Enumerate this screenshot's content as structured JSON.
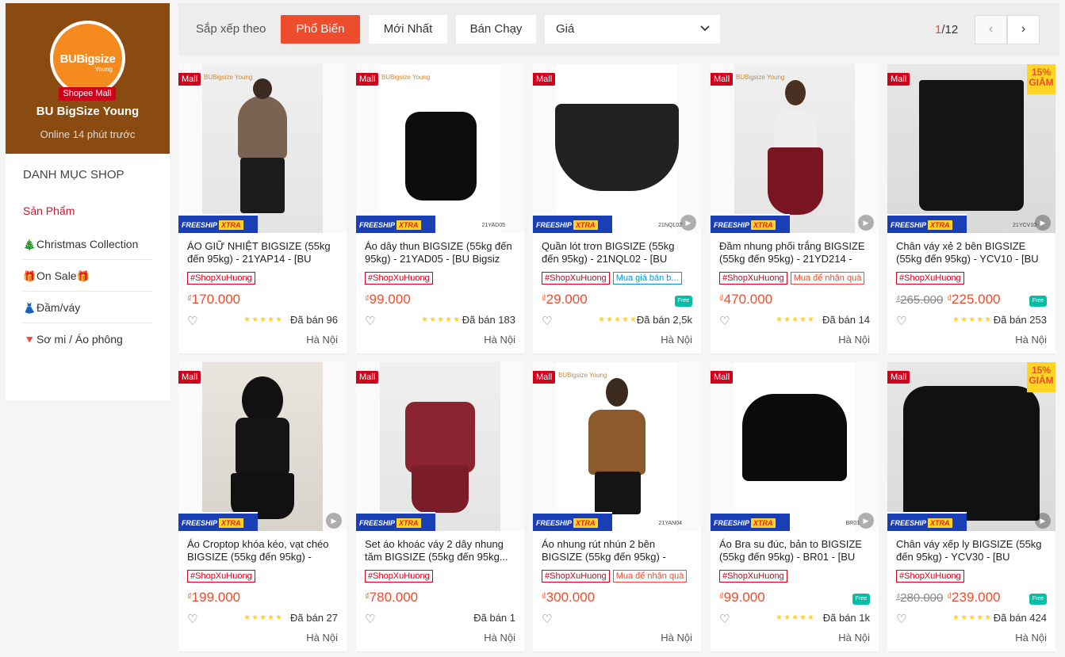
{
  "shop": {
    "avatar_name": "BUBigsize",
    "avatar_sub": "Young",
    "mall_badge": "Shopee Mall",
    "name": "BU BigSize Young",
    "status": "Online 14 phút trước"
  },
  "categories": {
    "title": "DANH MỤC SHOP",
    "items": [
      {
        "label": "Sản Phẩm",
        "icon": ""
      },
      {
        "label": "Christmas Collection",
        "icon": "christmas-tree-icon"
      },
      {
        "label": "On Sale",
        "icon": "gift-icon"
      },
      {
        "label": "Đầm/váy",
        "icon": "dress-icon"
      },
      {
        "label": "Sơ mi / Áo phông",
        "icon": "down-triangle-icon"
      }
    ]
  },
  "sortbar": {
    "label": "Sắp xếp theo",
    "options": [
      "Phổ Biến",
      "Mới Nhất",
      "Bán Chạy"
    ],
    "active": "Phổ Biến",
    "price_label": "Giá",
    "page_current": "1",
    "page_total": "/12"
  },
  "common": {
    "mall_tag": "Mall",
    "freeship": "FREESHIP",
    "xtra": "XTRA",
    "currency": "₫",
    "free_label": "Free",
    "brand_mark": "BUBigsize Young"
  },
  "products": [
    {
      "title": "ÁO GIỮ NHIỆT BIGSIZE (55kg đến 95kg) - 21YAP14 - [BU",
      "tags": [
        "#ShopXuHuong"
      ],
      "price": "170.000",
      "old_price": "",
      "sold": "Đã bán 96",
      "location": "Hà Nội",
      "stars": "★★★★★",
      "discount": "",
      "sku": "",
      "free": false,
      "play": false
    },
    {
      "title": "Áo dây thun BIGSIZE (55kg đến 95kg) - 21YAD05 - [BU Bigsiz",
      "tags": [
        "#ShopXuHuong"
      ],
      "price": "99.000",
      "old_price": "",
      "sold": "Đã bán 183",
      "location": "Hà Nội",
      "stars": "★★★★★",
      "discount": "",
      "sku": "21YAD05",
      "free": false,
      "play": false
    },
    {
      "title": "Quần lót trơn BIGSIZE (55kg đến 95kg) - 21NQL02 - [BU",
      "tags": [
        "#ShopXuHuong",
        "Mua giá bán b..."
      ],
      "price": "29.000",
      "old_price": "",
      "sold": "Đã bán 2,5k",
      "location": "Hà Nội",
      "stars": "★★★★★",
      "discount": "",
      "sku": "21NQL02",
      "free": true,
      "play": true
    },
    {
      "title": "Đầm nhung phối trắng BIGSIZE (55kg đến 95kg) - 21YD214 -",
      "tags": [
        "#ShopXuHuong",
        "Mua để nhận quà"
      ],
      "price": "470.000",
      "old_price": "",
      "sold": "Đã bán 14",
      "location": "Hà Nội",
      "stars": "★★★★★",
      "discount": "",
      "sku": "",
      "free": false,
      "play": true
    },
    {
      "title": "Chân váy xẻ 2 bên BIGSIZE (55kg đến 95kg) - YCV10 - [BU",
      "tags": [
        "#ShopXuHuong"
      ],
      "price": "225.000",
      "old_price": "265.000",
      "sold": "Đã bán 253",
      "location": "Hà Nội",
      "stars": "★★★★★",
      "discount": "15%\nGIẢM",
      "sku": "21YCV10",
      "free": true,
      "play": true
    },
    {
      "title": "Áo Croptop khóa kéo, vạt chéo BIGSIZE (55kg đến 95kg) -",
      "tags": [
        "#ShopXuHuong"
      ],
      "price": "199.000",
      "old_price": "",
      "sold": "Đã bán 27",
      "location": "Hà Nội",
      "stars": "★★★★★",
      "discount": "",
      "sku": "",
      "free": false,
      "play": true
    },
    {
      "title": "Set áo khoác váy 2 dây nhung tăm BIGSIZE (55kg đến 95kg...",
      "tags": [
        "#ShopXuHuong"
      ],
      "price": "780.000",
      "old_price": "",
      "sold": "Đã bán 1",
      "location": "Hà Nội",
      "stars": "",
      "discount": "",
      "sku": "",
      "free": false,
      "play": false
    },
    {
      "title": "Áo nhung rút nhún 2 bên BIGSIZE (55kg đến 95kg) -",
      "tags": [
        "#ShopXuHuong",
        "Mua để nhận quà"
      ],
      "price": "300.000",
      "old_price": "",
      "sold": "",
      "location": "Hà Nội",
      "stars": "",
      "discount": "",
      "sku": "21YAN04",
      "free": false,
      "play": false
    },
    {
      "title": "Áo Bra su đúc, bản to BIGSIZE (55kg đến 95kg) - BR01 - [BU",
      "tags": [
        "#ShopXuHuong"
      ],
      "price": "99.000",
      "old_price": "",
      "sold": "Đã bán 1k",
      "location": "Hà Nội",
      "stars": "★★★★★",
      "discount": "",
      "sku": "BR01",
      "free": true,
      "play": true
    },
    {
      "title": "Chân váy xếp ly BIGSIZE (55kg đến 95kg) - YCV30 - [BU",
      "tags": [
        "#ShopXuHuong"
      ],
      "price": "239.000",
      "old_price": "280.000",
      "sold": "Đã bán 424",
      "location": "Hà Nội",
      "stars": "★★★★★",
      "discount": "15%\nGIẢM",
      "sku": "",
      "free": true,
      "play": true
    }
  ]
}
